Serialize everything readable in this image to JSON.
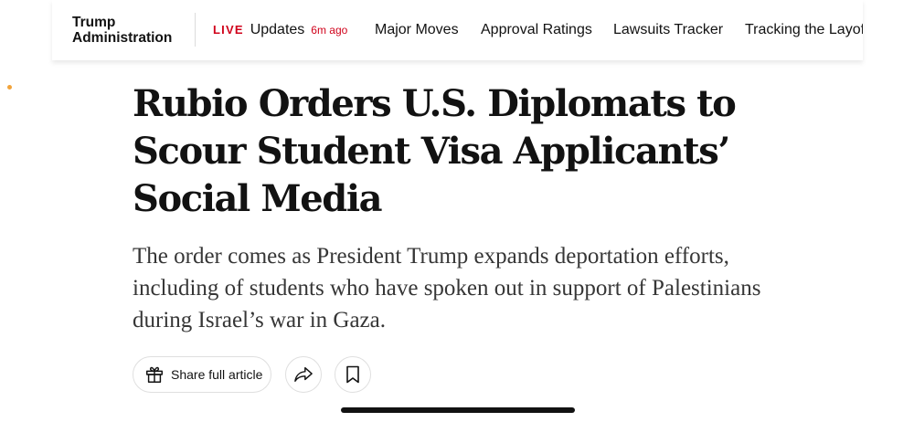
{
  "nav": {
    "section_title_line1": "Trump",
    "section_title_line2": "Administration",
    "live_badge": "LIVE",
    "live_label": "Updates",
    "live_time": "6m ago",
    "links": [
      "Major Moves",
      "Approval Ratings",
      "Lawsuits Tracker",
      "Tracking the Layoffs"
    ]
  },
  "article": {
    "headline": "Rubio Orders U.S. Diplomats to Scour Student Visa Applicants’ Social Media",
    "summary": "The order comes as President Trump expands deportation efforts, including of students who have spoken out in support of Palestinians during Israel’s war in Gaza."
  },
  "actions": {
    "share_label": "Share full article",
    "share_icon": "gift-icon",
    "forward_icon": "share-arrow-icon",
    "save_icon": "bookmark-icon"
  },
  "colors": {
    "live_red": "#d0021b",
    "accent_dot": "#f2a33a",
    "text": "#121212"
  }
}
